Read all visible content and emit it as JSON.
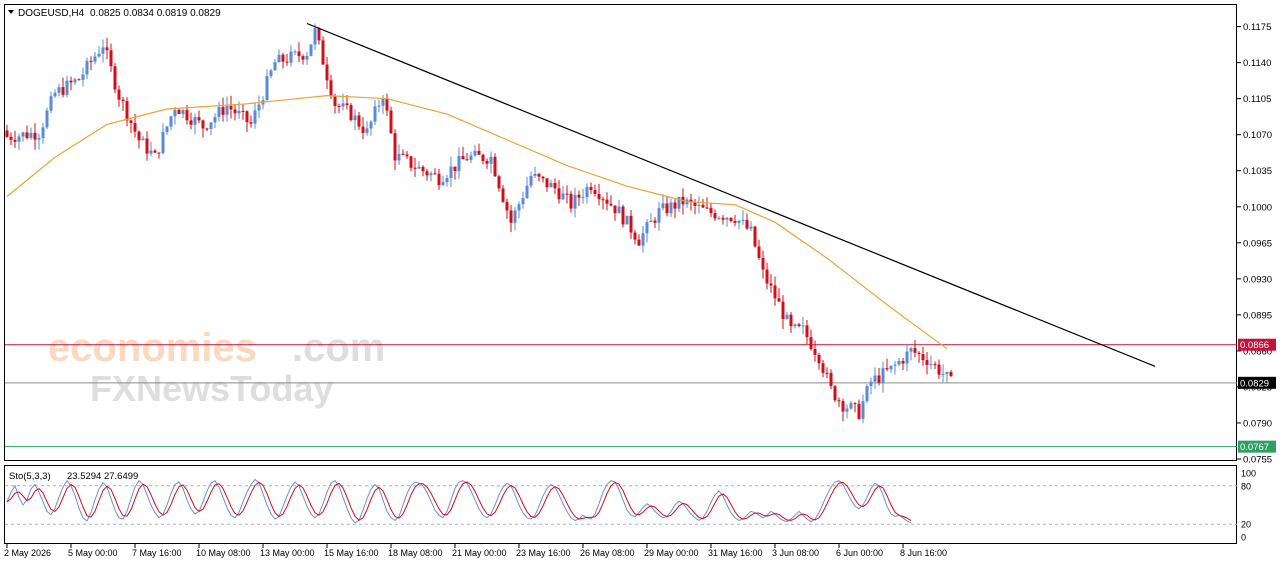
{
  "header": {
    "symbol": "DOGEUSD,H4",
    "ohlc": "0.0825 0.0834 0.0819 0.0829"
  },
  "watermark": {
    "brand_a": "economies",
    "brand_b": ".com",
    "brand_c": "FXNewsToday"
  },
  "colors": {
    "bull": "#5b8bd6",
    "bear": "#d10f1a",
    "ma": "#e8a436",
    "trend": "#000000",
    "resistance": "#c0143c",
    "current": "#8a8a8a",
    "support": "#2e9e66",
    "stoch_main": "#6a8fd0",
    "stoch_signal": "#d10f1a"
  },
  "chart_data": {
    "type": "candlestick",
    "price_axis": {
      "range": [
        0.0755,
        0.1195
      ],
      "ticks": [
        "0.1175",
        "0.1140",
        "0.1105",
        "0.1070",
        "0.1035",
        "0.1000",
        "0.0965",
        "0.0930",
        "0.0895",
        "0.0860",
        "0.0825",
        "0.0790",
        "0.0755"
      ]
    },
    "time_axis": {
      "labels": [
        "2 May 2026",
        "5 May 00:00",
        "7 May 16:00",
        "10 May 08:00",
        "13 May 00:00",
        "15 May 16:00",
        "18 May 08:00",
        "21 May 00:00",
        "23 May 16:00",
        "26 May 08:00",
        "29 May 00:00",
        "31 May 16:00",
        "3 Jun 08:00",
        "6 Jun 00:00",
        "8 Jun 16:00"
      ],
      "label_bar_index": [
        0,
        16,
        32,
        48,
        64,
        80,
        96,
        112,
        128,
        144,
        160,
        176,
        192,
        208,
        224
      ]
    },
    "anchors": [
      [
        0,
        0.1068
      ],
      [
        8,
        0.1072
      ],
      [
        12,
        0.111
      ],
      [
        18,
        0.1124
      ],
      [
        24,
        0.1158
      ],
      [
        28,
        0.1108
      ],
      [
        33,
        0.1065
      ],
      [
        37,
        0.1048
      ],
      [
        42,
        0.1098
      ],
      [
        49,
        0.1078
      ],
      [
        55,
        0.1098
      ],
      [
        61,
        0.108
      ],
      [
        67,
        0.114
      ],
      [
        75,
        0.115
      ],
      [
        77,
        0.117
      ],
      [
        82,
        0.11
      ],
      [
        86,
        0.109
      ],
      [
        90,
        0.1072
      ],
      [
        94,
        0.111
      ],
      [
        97,
        0.105
      ],
      [
        104,
        0.1035
      ],
      [
        108,
        0.1028
      ],
      [
        115,
        0.1048
      ],
      [
        121,
        0.1048
      ],
      [
        126,
        0.0985
      ],
      [
        131,
        0.103
      ],
      [
        137,
        0.1018
      ],
      [
        141,
        0.1002
      ],
      [
        146,
        0.1022
      ],
      [
        153,
        0.0995
      ],
      [
        158,
        0.0968
      ],
      [
        163,
        0.0995
      ],
      [
        169,
        0.1005
      ],
      [
        175,
        0.0995
      ],
      [
        182,
        0.099
      ],
      [
        186,
        0.0975
      ],
      [
        189,
        0.0935
      ],
      [
        193,
        0.0905
      ],
      [
        196,
        0.088
      ],
      [
        199,
        0.088
      ],
      [
        203,
        0.0855
      ],
      [
        206,
        0.0822
      ],
      [
        209,
        0.0808
      ],
      [
        213,
        0.08
      ],
      [
        216,
        0.083
      ],
      [
        221,
        0.0842
      ],
      [
        226,
        0.086
      ],
      [
        230,
        0.0852
      ],
      [
        234,
        0.0838
      ],
      [
        236,
        0.0829
      ]
    ],
    "ma": {
      "label": "",
      "points": [
        [
          0,
          0.101
        ],
        [
          12,
          0.1048
        ],
        [
          25,
          0.108
        ],
        [
          40,
          0.1095
        ],
        [
          60,
          0.11
        ],
        [
          80,
          0.1108
        ],
        [
          95,
          0.1105
        ],
        [
          110,
          0.109
        ],
        [
          125,
          0.1065
        ],
        [
          140,
          0.104
        ],
        [
          155,
          0.102
        ],
        [
          170,
          0.1005
        ],
        [
          182,
          0.1002
        ],
        [
          192,
          0.0985
        ],
        [
          205,
          0.095
        ],
        [
          220,
          0.0905
        ],
        [
          235,
          0.0862
        ]
      ]
    },
    "trendline": {
      "from": [
        75,
        0.1178
      ],
      "to": [
        287,
        0.0845
      ]
    },
    "levels": [
      {
        "value": 0.0866,
        "label": "0.0866"
      },
      {
        "value": 0.0829,
        "label": "0.0829"
      },
      {
        "value": 0.0767,
        "label": "0.0767"
      }
    ],
    "stochastic": {
      "title": "Sto(5,3,3)",
      "values": "23.5294 27.6499",
      "range": [
        0,
        100
      ],
      "ticks": [
        "100",
        "80",
        "20",
        "0"
      ],
      "levels": [
        80,
        20
      ],
      "main": [
        55,
        70,
        80,
        62,
        50,
        58,
        75,
        82,
        70,
        55,
        40,
        35,
        45,
        62,
        78,
        88,
        80,
        65,
        45,
        30,
        25,
        38,
        58,
        75,
        85,
        78,
        60,
        42,
        30,
        28,
        40,
        60,
        78,
        88,
        82,
        66,
        50,
        38,
        30,
        35,
        50,
        68,
        82,
        86,
        76,
        58,
        44,
        36,
        40,
        55,
        72,
        84,
        88,
        78,
        62,
        46,
        34,
        30,
        38,
        55,
        70,
        82,
        90,
        85,
        68,
        50,
        36,
        28,
        32,
        48,
        64,
        78,
        86,
        80,
        64,
        48,
        36,
        30,
        36,
        52,
        70,
        84,
        88,
        80,
        62,
        45,
        30,
        22,
        26,
        42,
        60,
        75,
        82,
        76,
        58,
        40,
        30,
        26,
        32,
        50,
        68,
        80,
        86,
        84,
        80,
        70,
        56,
        42,
        34,
        30,
        40,
        58,
        76,
        86,
        88,
        84,
        72,
        58,
        44,
        34,
        30,
        36,
        50,
        66,
        78,
        84,
        80,
        66,
        50,
        38,
        30,
        28,
        34,
        48,
        64,
        76,
        82,
        78,
        66,
        52,
        40,
        30,
        26,
        28,
        34,
        30,
        28,
        36,
        52,
        70,
        82,
        88,
        86,
        74,
        58,
        42,
        34,
        32,
        38,
        46,
        52,
        48,
        40,
        34,
        30,
        32,
        40,
        50,
        56,
        52,
        44,
        36,
        30,
        26,
        30,
        40,
        54,
        66,
        72,
        64,
        50,
        38,
        30,
        26,
        28,
        34,
        40,
        38,
        34,
        30,
        34,
        40,
        36,
        30,
        26,
        24,
        28,
        34,
        40,
        34,
        28,
        24,
        28,
        38,
        52,
        66,
        78,
        86,
        88,
        82,
        70,
        58,
        48,
        44,
        50,
        62,
        76,
        84,
        80,
        66,
        48,
        36,
        32,
        34,
        30,
        25,
        22
      ]
    }
  }
}
